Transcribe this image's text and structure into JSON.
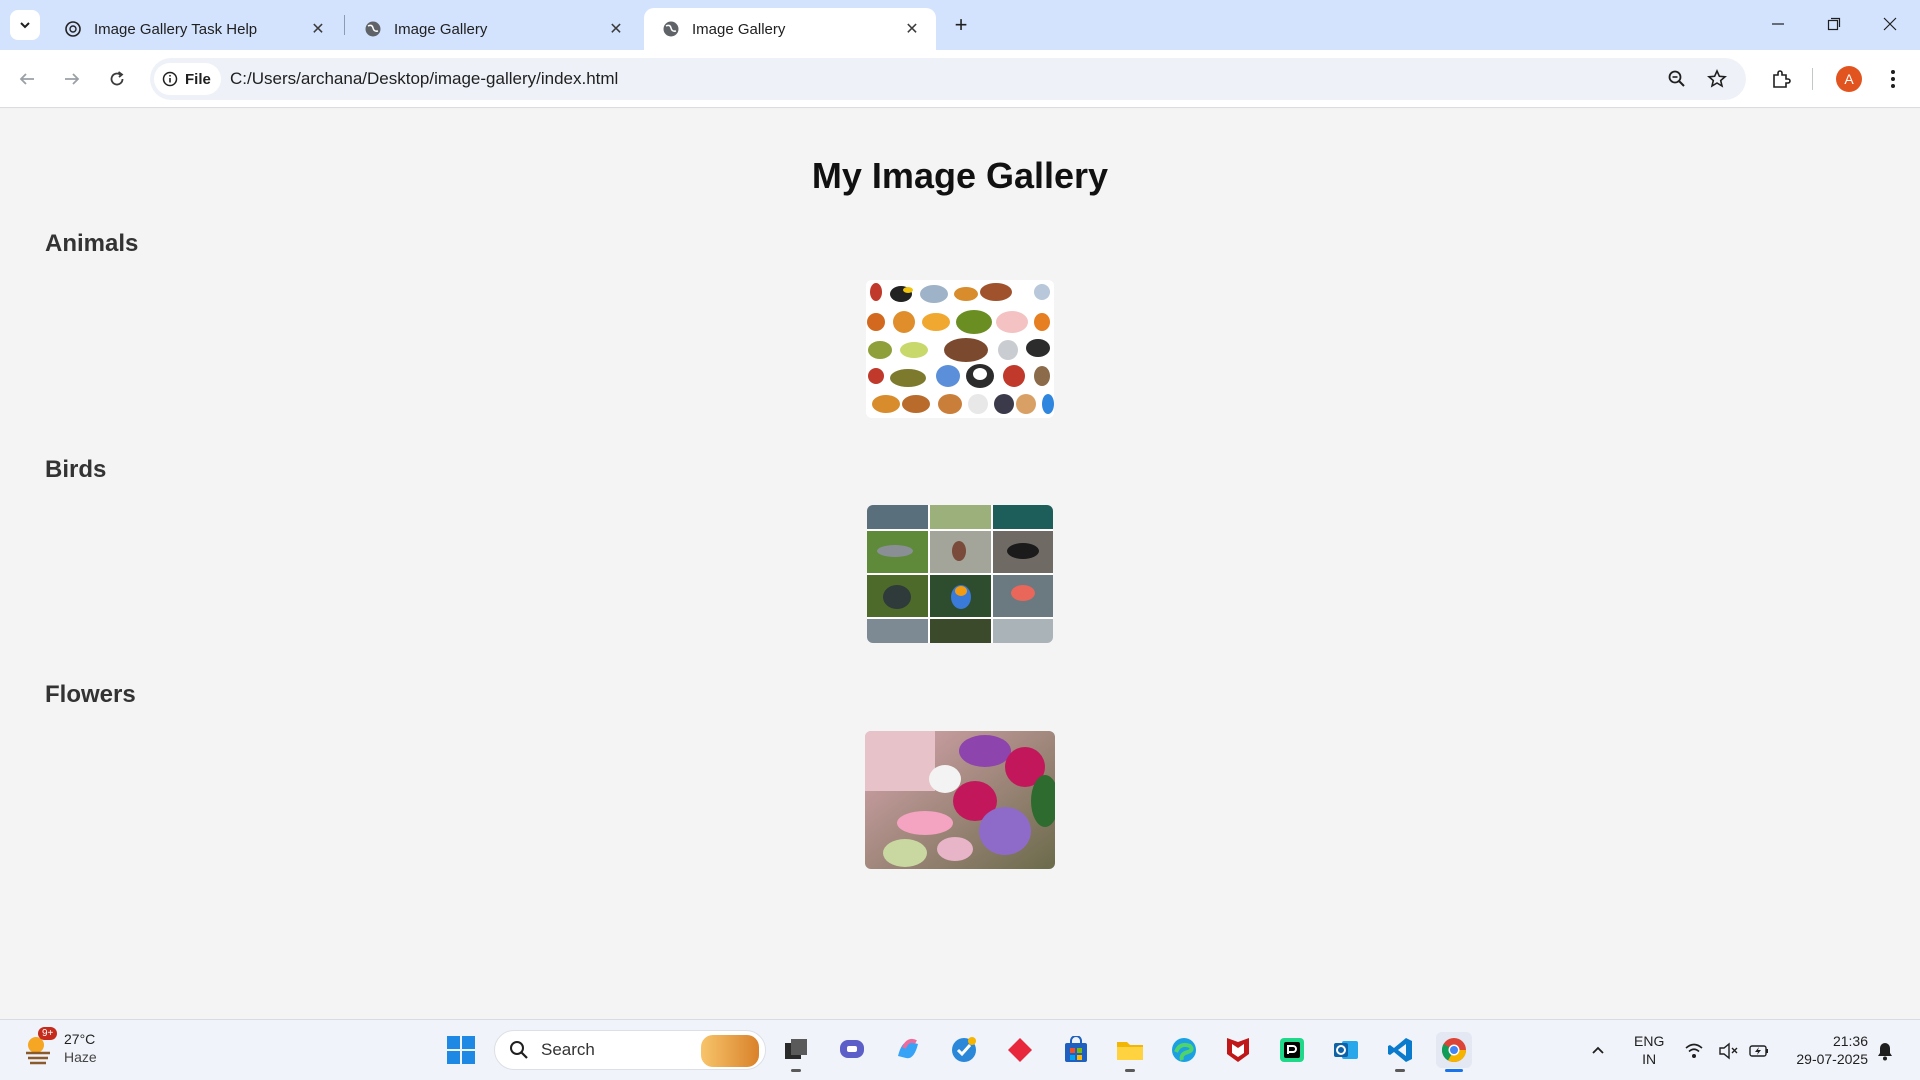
{
  "browser": {
    "tabs": [
      {
        "title": "Image Gallery Task Help",
        "active": false
      },
      {
        "title": "Image Gallery",
        "active": false
      },
      {
        "title": "Image Gallery",
        "active": true
      }
    ],
    "address": {
      "chip_label": "File",
      "url": "C:/Users/archana/Desktop/image-gallery/index.html"
    },
    "profile_initial": "A"
  },
  "page": {
    "title": "My Image Gallery",
    "sections": [
      {
        "title": "Animals",
        "image_alt": "animals collage"
      },
      {
        "title": "Birds",
        "image_alt": "birds collage"
      },
      {
        "title": "Flowers",
        "image_alt": "flower bouquet"
      }
    ]
  },
  "taskbar": {
    "weather": {
      "temp": "27°C",
      "condition": "Haze",
      "badge": "9+"
    },
    "search_placeholder": "Search",
    "language": {
      "line1": "ENG",
      "line2": "IN"
    },
    "clock": {
      "time": "21:36",
      "date": "29-07-2025"
    },
    "apps": [
      "file-explorer-dark-icon",
      "chat-icon",
      "copilot-icon",
      "ms-todo-icon",
      "diamond-app-icon",
      "store-icon",
      "folder-icon",
      "edge-icon",
      "mcafee-icon",
      "pycharm-icon",
      "outlook-icon",
      "vscode-icon",
      "chrome-icon"
    ]
  },
  "colors": {
    "tabstrip": "#d3e3fd",
    "page_bg": "#f4f4f4",
    "avatar": "#e2541f"
  }
}
